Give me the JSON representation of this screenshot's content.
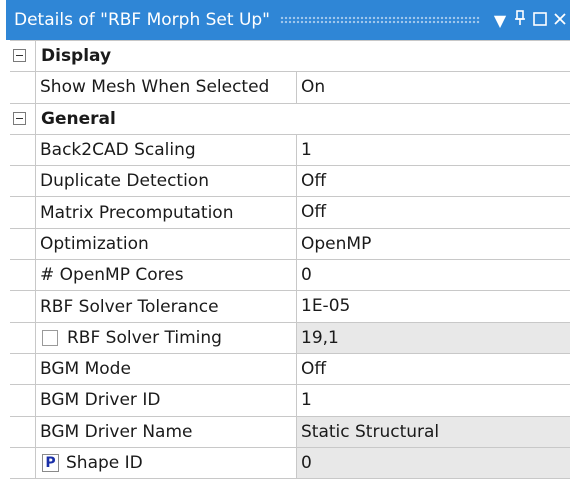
{
  "titlebar": {
    "title": "Details of \"RBF Morph Set Up\"",
    "dropdown_icon": "▼",
    "pin_icon": "F",
    "maximize_icon": "□",
    "close_icon": "✕"
  },
  "groups": {
    "display": {
      "label": "Display",
      "rows": [
        {
          "name": "Show Mesh When Selected",
          "value": "On"
        }
      ]
    },
    "general": {
      "label": "General",
      "rows": [
        {
          "name": "Back2CAD Scaling",
          "value": "1"
        },
        {
          "name": "Duplicate Detection",
          "value": "Off"
        },
        {
          "name": "Matrix Precomputation",
          "value": "Off"
        },
        {
          "name": "Optimization",
          "value": "OpenMP"
        },
        {
          "name": "# OpenMP Cores",
          "value": "0"
        },
        {
          "name": "RBF Solver Tolerance",
          "value": "1E-05"
        },
        {
          "name": "RBF Solver Timing",
          "value": "19,1"
        },
        {
          "name": "BGM Mode",
          "value": "Off"
        },
        {
          "name": "BGM Driver ID",
          "value": "1"
        },
        {
          "name": "BGM Driver Name",
          "value": "Static Structural"
        },
        {
          "name": "Shape ID",
          "value": "0"
        }
      ]
    }
  },
  "parameter_badge": "P"
}
